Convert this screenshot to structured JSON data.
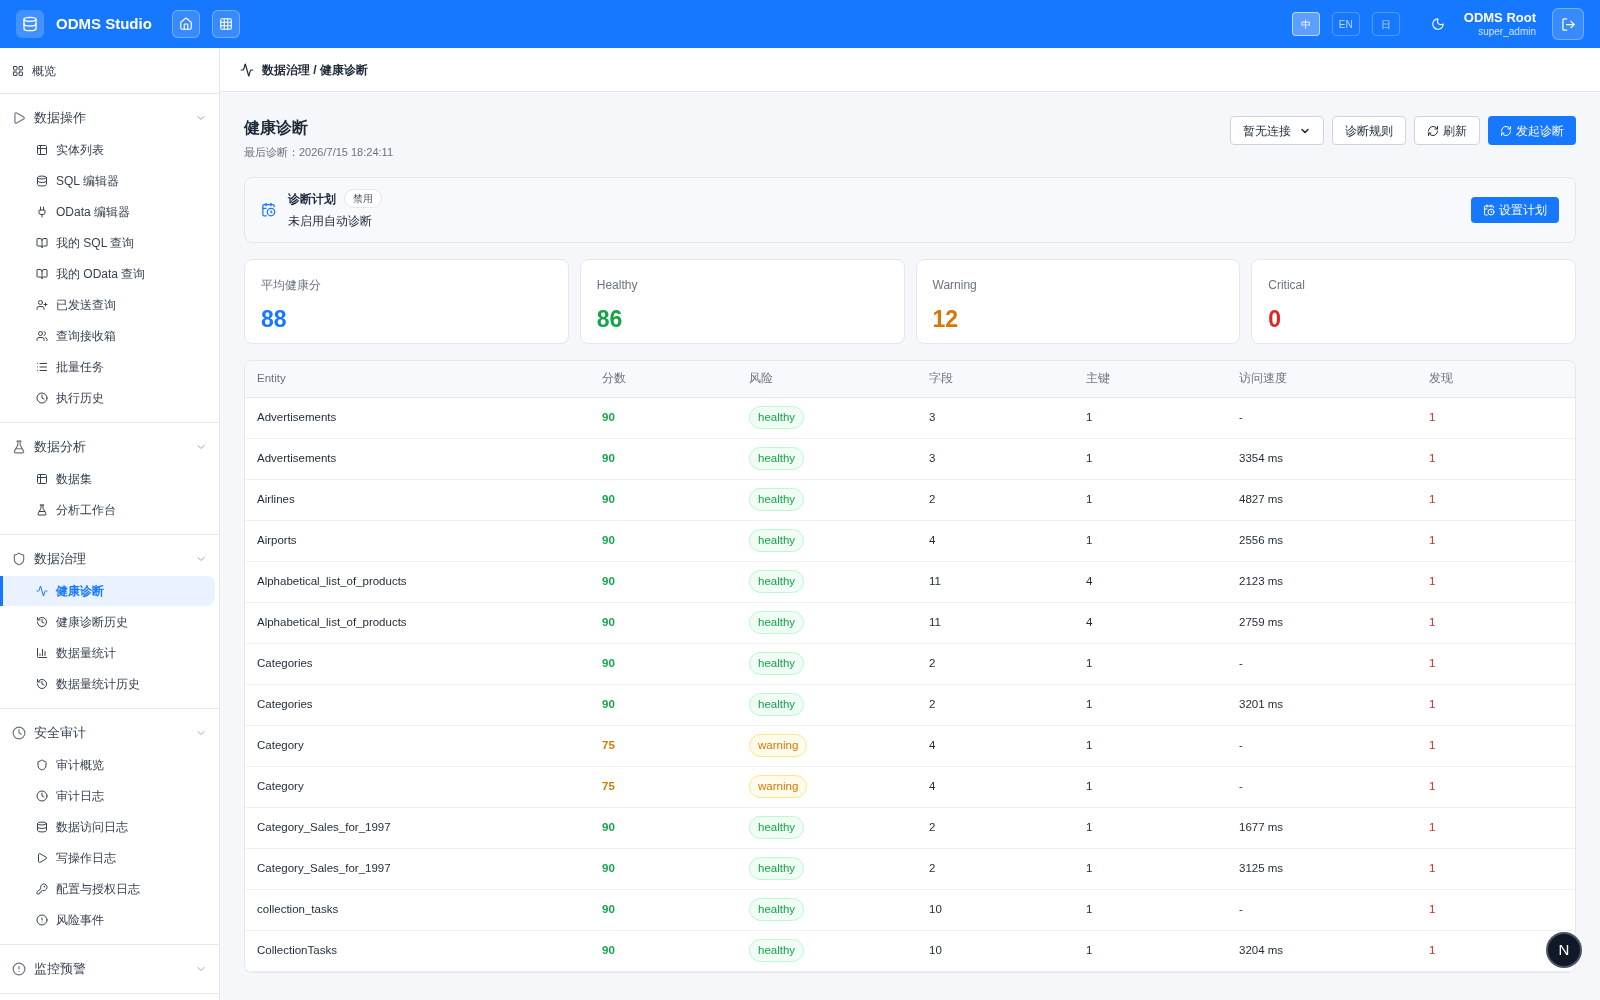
{
  "app": {
    "title": "ODMS Studio"
  },
  "languages": [
    {
      "label": "中",
      "selected": true
    },
    {
      "label": "EN",
      "selected": false
    },
    {
      "label": "日",
      "selected": false
    }
  ],
  "user": {
    "name": "ODMS Root",
    "role": "super_admin"
  },
  "breadcrumb": "数据治理 / 健康诊断",
  "sidebar": {
    "top": {
      "label": "概览",
      "selected": false
    },
    "groups": [
      {
        "title": "数据操作",
        "expanded": true,
        "children": [
          {
            "label": "实体列表",
            "selected": false
          },
          {
            "label": "SQL 编辑器",
            "selected": false
          },
          {
            "label": "OData 编辑器",
            "selected": false
          },
          {
            "label": "我的 SQL 查询",
            "selected": false
          },
          {
            "label": "我的 OData 查询",
            "selected": false
          },
          {
            "label": "已发送查询",
            "selected": false
          },
          {
            "label": "查询接收箱",
            "selected": false
          },
          {
            "label": "批量任务",
            "selected": false
          },
          {
            "label": "执行历史",
            "selected": false
          }
        ]
      },
      {
        "title": "数据分析",
        "expanded": true,
        "children": [
          {
            "label": "数据集",
            "selected": false
          },
          {
            "label": "分析工作台",
            "selected": false
          }
        ]
      },
      {
        "title": "数据治理",
        "expanded": true,
        "children": [
          {
            "label": "健康诊断",
            "selected": true
          },
          {
            "label": "健康诊断历史",
            "selected": false
          },
          {
            "label": "数据量统计",
            "selected": false
          },
          {
            "label": "数据量统计历史",
            "selected": false
          }
        ]
      },
      {
        "title": "安全审计",
        "expanded": true,
        "children": [
          {
            "label": "审计概览",
            "selected": false
          },
          {
            "label": "审计日志",
            "selected": false
          },
          {
            "label": "数据访问日志",
            "selected": false
          },
          {
            "label": "写操作日志",
            "selected": false
          },
          {
            "label": "配置与授权日志",
            "selected": false
          },
          {
            "label": "风险事件",
            "selected": false
          }
        ]
      },
      {
        "title": "监控预警",
        "expanded": true
      }
    ]
  },
  "page": {
    "title": "健康诊断",
    "subtitle": "最后诊断：2026/7/15 18:24:11",
    "connection_select": "暂无连接",
    "buttons": [
      {
        "label": "诊断规则",
        "kind": "plain"
      },
      {
        "label": "刷新",
        "kind": "refresh"
      },
      {
        "label": "发起诊断",
        "kind": "primary"
      }
    ]
  },
  "schedule": {
    "title": "诊断计划",
    "badge": "禁用",
    "description": "未启用自动诊断",
    "button": "设置计划"
  },
  "stats": [
    {
      "label": "平均健康分",
      "value": "88",
      "color": "#1677ff"
    },
    {
      "label": "Healthy",
      "value": "86",
      "color": "#16a34a"
    },
    {
      "label": "Warning",
      "value": "12",
      "color": "#d97706"
    },
    {
      "label": "Critical",
      "value": "0",
      "color": "#dc2626"
    }
  ],
  "table": {
    "columns": [
      "Entity",
      "分数",
      "风险",
      "字段",
      "主键",
      "访问速度",
      "发现"
    ],
    "rows": [
      {
        "entity": "Advertisements",
        "score": "90",
        "risk": "healthy",
        "kind": "healthy",
        "fields": "3",
        "keys": "1",
        "speed": "-",
        "findings": "1"
      },
      {
        "entity": "Advertisements",
        "score": "90",
        "risk": "healthy",
        "kind": "healthy",
        "fields": "3",
        "keys": "1",
        "speed": "3354 ms",
        "findings": "1"
      },
      {
        "entity": "Airlines",
        "score": "90",
        "risk": "healthy",
        "kind": "healthy",
        "fields": "2",
        "keys": "1",
        "speed": "4827 ms",
        "findings": "1"
      },
      {
        "entity": "Airports",
        "score": "90",
        "risk": "healthy",
        "kind": "healthy",
        "fields": "4",
        "keys": "1",
        "speed": "2556 ms",
        "findings": "1"
      },
      {
        "entity": "Alphabetical_list_of_products",
        "score": "90",
        "risk": "healthy",
        "kind": "healthy",
        "fields": "11",
        "keys": "4",
        "speed": "2123 ms",
        "findings": "1"
      },
      {
        "entity": "Alphabetical_list_of_products",
        "score": "90",
        "risk": "healthy",
        "kind": "healthy",
        "fields": "11",
        "keys": "4",
        "speed": "2759 ms",
        "findings": "1"
      },
      {
        "entity": "Categories",
        "score": "90",
        "risk": "healthy",
        "kind": "healthy",
        "fields": "2",
        "keys": "1",
        "speed": "-",
        "findings": "1"
      },
      {
        "entity": "Categories",
        "score": "90",
        "risk": "healthy",
        "kind": "healthy",
        "fields": "2",
        "keys": "1",
        "speed": "3201 ms",
        "findings": "1"
      },
      {
        "entity": "Category",
        "score": "75",
        "risk": "warning",
        "kind": "warning",
        "fields": "4",
        "keys": "1",
        "speed": "-",
        "findings": "1"
      },
      {
        "entity": "Category",
        "score": "75",
        "risk": "warning",
        "kind": "warning",
        "fields": "4",
        "keys": "1",
        "speed": "-",
        "findings": "1"
      },
      {
        "entity": "Category_Sales_for_1997",
        "score": "90",
        "risk": "healthy",
        "kind": "healthy",
        "fields": "2",
        "keys": "1",
        "speed": "1677 ms",
        "findings": "1"
      },
      {
        "entity": "Category_Sales_for_1997",
        "score": "90",
        "risk": "healthy",
        "kind": "healthy",
        "fields": "2",
        "keys": "1",
        "speed": "3125 ms",
        "findings": "1"
      },
      {
        "entity": "collection_tasks",
        "score": "90",
        "risk": "healthy",
        "kind": "healthy",
        "fields": "10",
        "keys": "1",
        "speed": "-",
        "findings": "1"
      },
      {
        "entity": "CollectionTasks",
        "score": "90",
        "risk": "healthy",
        "kind": "healthy",
        "fields": "10",
        "keys": "1",
        "speed": "3204 ms",
        "findings": "1"
      }
    ]
  },
  "floating_button": {
    "label": "N"
  }
}
